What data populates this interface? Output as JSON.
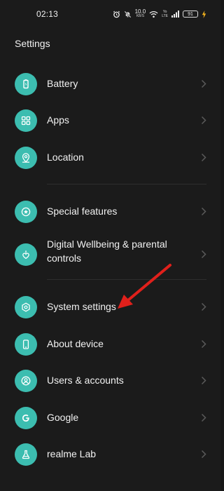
{
  "status_bar": {
    "time": "02:13",
    "net_speed_value": "10.0",
    "net_speed_unit": "KB/S",
    "volte_line1": "Yo",
    "volte_line2": "LTE",
    "battery_level": "91",
    "icons": [
      "alarm-icon",
      "mute-icon",
      "wifi-icon",
      "signal-icon",
      "charging-icon"
    ]
  },
  "page": {
    "title": "Settings"
  },
  "groups": [
    {
      "items": [
        {
          "label": "Battery",
          "icon": "battery-icon"
        },
        {
          "label": "Apps",
          "icon": "apps-grid-icon"
        },
        {
          "label": "Location",
          "icon": "location-pin-icon"
        }
      ]
    },
    {
      "items": [
        {
          "label": "Special features",
          "icon": "star-icon"
        },
        {
          "label": "Digital Wellbeing & parental controls",
          "icon": "wellbeing-icon"
        }
      ]
    },
    {
      "items": [
        {
          "label": "System settings",
          "icon": "gear-hexagon-icon"
        },
        {
          "label": "About device",
          "icon": "phone-icon"
        },
        {
          "label": "Users & accounts",
          "icon": "user-icon"
        },
        {
          "label": "Google",
          "icon": "google-icon"
        },
        {
          "label": "realme Lab",
          "icon": "flask-icon"
        }
      ]
    }
  ],
  "colors": {
    "background": "#1b1b1b",
    "icon_circle": "#3cbdb0",
    "text": "#f2f2f2",
    "chevron": "#5a5a5a",
    "annotation_arrow": "#e0201b"
  }
}
